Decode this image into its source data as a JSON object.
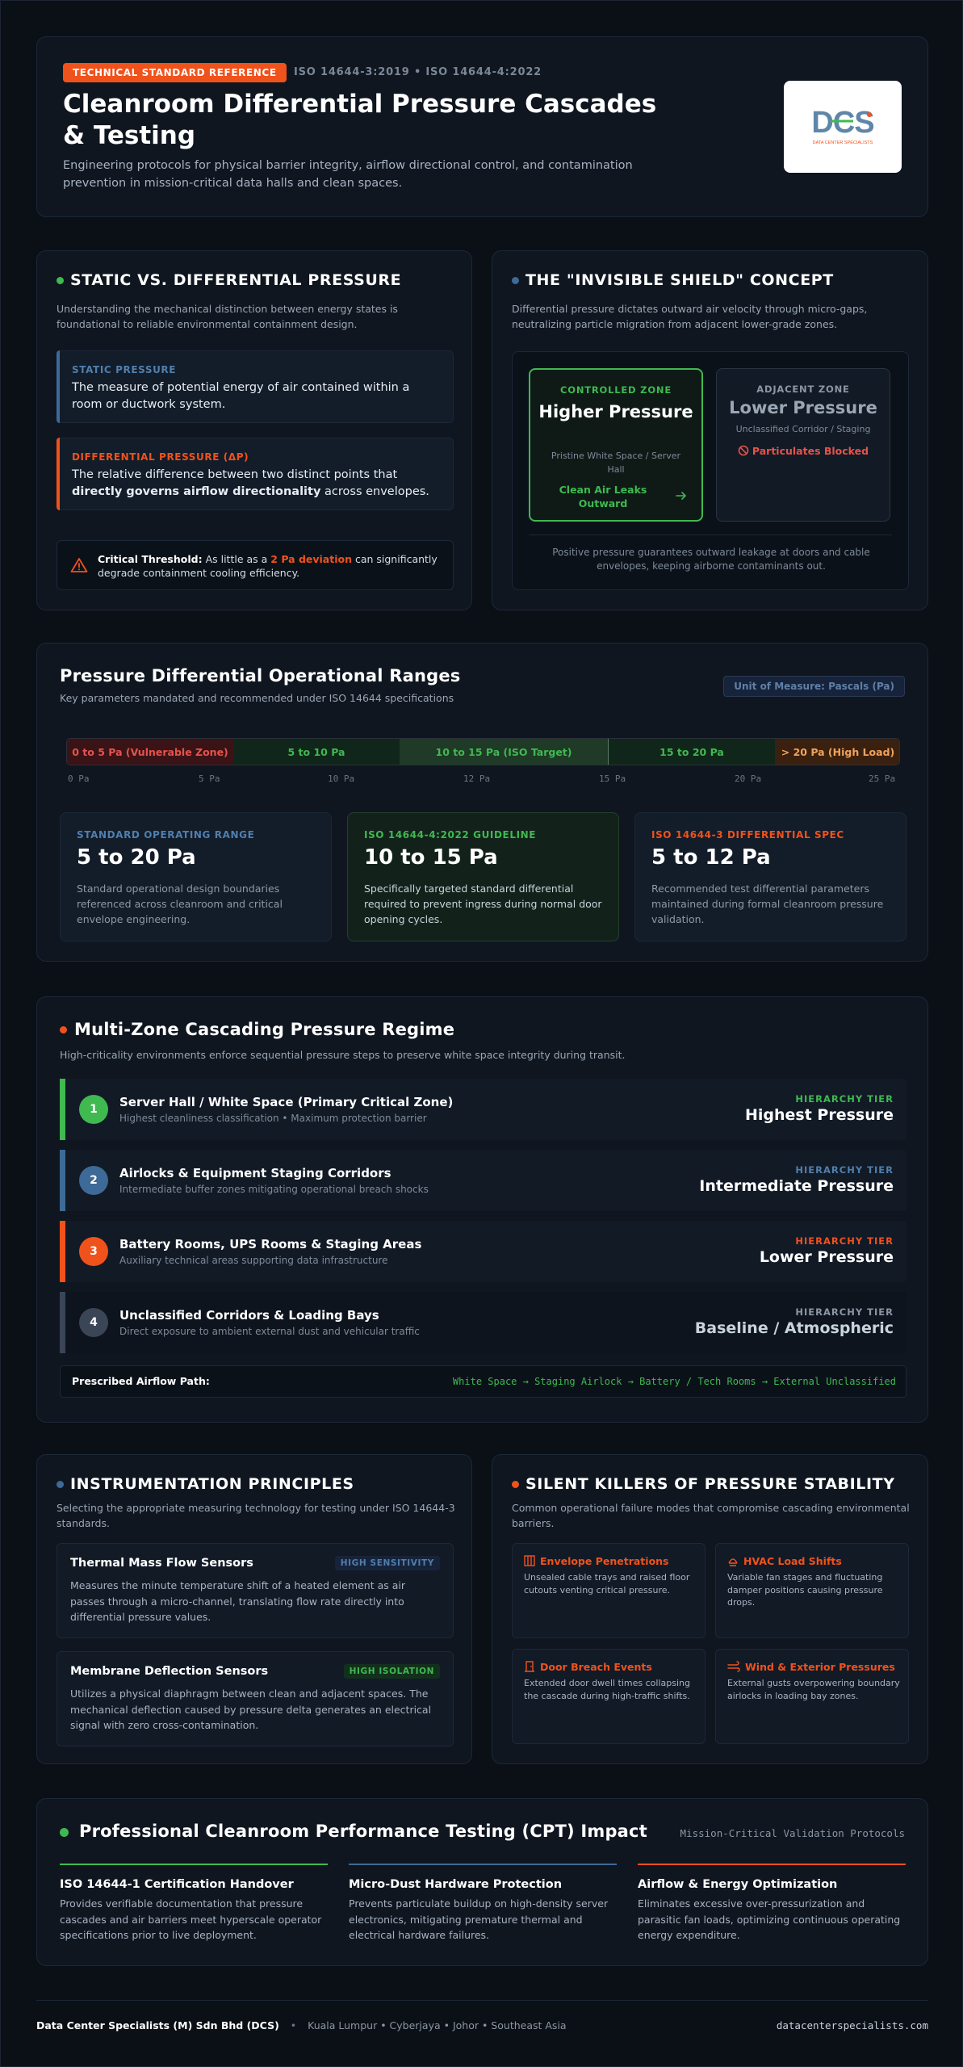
{
  "header": {
    "badge": "TECHNICAL STANDARD REFERENCE",
    "standards": "ISO 14644-3:2019 • ISO 14644-4:2022",
    "title": "Cleanroom Differential Pressure Cascades & Testing",
    "subtitle": "Engineering protocols for physical barrier integrity, airflow directional control, and contamination prevention in mission-critical data halls and clean spaces.",
    "logo": {
      "mark": "DCS",
      "tagline": "DATA CENTER SPECIALISTS"
    }
  },
  "static_vs_diff": {
    "title": "STATIC VS. DIFFERENTIAL PRESSURE",
    "desc": "Understanding the mechanical distinction between energy states is foundational to reliable environmental containment design.",
    "static": {
      "label": "STATIC PRESSURE",
      "text": "The measure of potential energy of air contained within a room or ductwork system."
    },
    "differential": {
      "label": "DIFFERENTIAL PRESSURE (ΔP)",
      "text_a": "The relative difference between two distinct points that ",
      "text_bold": "directly governs airflow directionality",
      "text_b": " across envelopes."
    },
    "threshold": {
      "bold": "Critical Threshold:",
      "text_a": " As little as a ",
      "highlight": "2 Pa deviation",
      "text_b": " can significantly degrade containment cooling efficiency."
    }
  },
  "shield": {
    "title": "THE \"INVISIBLE SHIELD\" CONCEPT",
    "desc": "Differential pressure dictates outward air velocity through micro-gaps, neutralizing particle migration from adjacent lower-grade zones.",
    "controlled": {
      "label": "CONTROLLED ZONE",
      "heading": "Higher Pressure",
      "sub": "Pristine White Space / Server Hall",
      "flow": "Clean Air Leaks Outward"
    },
    "adjacent": {
      "label": "ADJACENT ZONE",
      "heading": "Lower Pressure",
      "sub": "Unclassified Corridor / Staging",
      "blocked": "Particulates Blocked"
    },
    "note": "Positive pressure guarantees outward leakage at doors and cable envelopes, keeping airborne contaminants out."
  },
  "ranges": {
    "title": "Pressure Differential Operational Ranges",
    "desc": "Key parameters mandated and recommended under ISO 14644 specifications",
    "unit": "Unit of Measure: Pascals (Pa)",
    "segments": [
      {
        "label": "0 to 5 Pa (Vulnerable Zone)",
        "color": "#e5534b"
      },
      {
        "label": "5 to 10 Pa",
        "color": "#3fb950"
      },
      {
        "label": "10 to 15 Pa (ISO Target)",
        "color": "#3fb950"
      },
      {
        "label": "15 to 20 Pa",
        "color": "#3fb950"
      },
      {
        "label": "> 20 Pa (High Load)",
        "color": "#f0a35c"
      }
    ],
    "ticks": [
      "0 Pa",
      "5 Pa",
      "10 Pa",
      "12 Pa",
      "15 Pa",
      "20 Pa",
      "25 Pa"
    ],
    "cards": [
      {
        "label": "STANDARD OPERATING RANGE",
        "value": "5 to 20 Pa",
        "desc": "Standard operational design boundaries referenced across cleanroom and critical envelope engineering."
      },
      {
        "label": "ISO 14644-4:2022 GUIDELINE",
        "value": "10 to 15 Pa",
        "desc": "Specifically targeted standard differential required to prevent ingress during normal door opening cycles."
      },
      {
        "label": "ISO 14644-3 DIFFERENTIAL SPEC",
        "value": "5 to 12 Pa",
        "desc": "Recommended test differential parameters maintained during formal cleanroom pressure validation."
      }
    ]
  },
  "zones": {
    "title": "Multi-Zone Cascading Pressure Regime",
    "desc": "High-criticality environments enforce sequential pressure steps to preserve white space integrity during transit.",
    "rows": [
      {
        "num": "1",
        "title": "Server Hall / White Space (Primary Critical Zone)",
        "desc": "Highest cleanliness classification • Maximum protection barrier",
        "tier_label": "HIERARCHY TIER",
        "tier": "Highest Pressure",
        "color": "#3fb950"
      },
      {
        "num": "2",
        "title": "Airlocks & Equipment Staging Corridors",
        "desc": "Intermediate buffer zones mitigating operational breach shocks",
        "tier_label": "HIERARCHY TIER",
        "tier": "Intermediate Pressure",
        "color": "#3d6a96"
      },
      {
        "num": "3",
        "title": "Battery Rooms, UPS Rooms & Staging Areas",
        "desc": "Auxiliary technical areas supporting data infrastructure",
        "tier_label": "HIERARCHY TIER",
        "tier": "Lower Pressure",
        "color": "#f0521c"
      },
      {
        "num": "4",
        "title": "Unclassified Corridors & Loading Bays",
        "desc": "Direct exposure to ambient external dust and vehicular traffic",
        "tier_label": "HIERARCHY TIER",
        "tier": "Baseline / Atmospheric",
        "color": "#3a4556"
      }
    ],
    "path_label": "Prescribed Airflow Path:",
    "path": "White Space → Staging Airlock → Battery / Tech Rooms → External Unclassified"
  },
  "instrumentation": {
    "title": "INSTRUMENTATION PRINCIPLES",
    "desc": "Selecting the appropriate measuring technology for testing under ISO 14644-3 standards.",
    "items": [
      {
        "title": "Thermal Mass Flow Sensors",
        "badge": "HIGH SENSITIVITY",
        "desc": "Measures the minute temperature shift of a heated element as air passes through a micro-channel, translating flow rate directly into differential pressure values."
      },
      {
        "title": "Membrane Deflection Sensors",
        "badge": "HIGH ISOLATION",
        "desc": "Utilizes a physical diaphragm between clean and adjacent spaces. The mechanical deflection caused by pressure delta generates an electrical signal with zero cross-contamination."
      }
    ]
  },
  "killers": {
    "title": "SILENT KILLERS OF PRESSURE STABILITY",
    "desc": "Common operational failure modes that compromise cascading environmental barriers.",
    "items": [
      {
        "icon": "grid-icon",
        "title": "Envelope Penetrations",
        "desc": "Unsealed cable trays and raised floor cutouts venting critical pressure."
      },
      {
        "icon": "fan-icon",
        "title": "HVAC Load Shifts",
        "desc": "Variable fan stages and fluctuating damper positions causing pressure drops."
      },
      {
        "icon": "door-icon",
        "title": "Door Breach Events",
        "desc": "Extended door dwell times collapsing the cascade during high-traffic shifts."
      },
      {
        "icon": "wind-icon",
        "title": "Wind & Exterior Pressures",
        "desc": "External gusts overpowering boundary airlocks in loading bay zones."
      }
    ]
  },
  "cpt": {
    "title": "Professional Cleanroom Performance Testing (CPT) Impact",
    "tag": "Mission-Critical Validation Protocols",
    "cols": [
      {
        "title": "ISO 14644-1 Certification Handover",
        "desc": "Provides verifiable documentation that pressure cascades and air barriers meet hyperscale operator specifications prior to live deployment.",
        "color": "#3fb950"
      },
      {
        "title": "Micro-Dust Hardware Protection",
        "desc": "Prevents particulate buildup on high-density server electronics, mitigating premature thermal and electrical hardware failures.",
        "color": "#3d6a96"
      },
      {
        "title": "Airflow & Energy Optimization",
        "desc": "Eliminates excessive over-pressurization and parasitic fan loads, optimizing continuous operating energy expenditure.",
        "color": "#f0521c"
      }
    ]
  },
  "footer": {
    "company": "Data Center Specialists (M) Sdn Bhd (DCS)",
    "sep": "•",
    "locations": "Kuala Lumpur • Cyberjaya • Johor • Southeast Asia",
    "url": "datacenterspecialists.com"
  }
}
